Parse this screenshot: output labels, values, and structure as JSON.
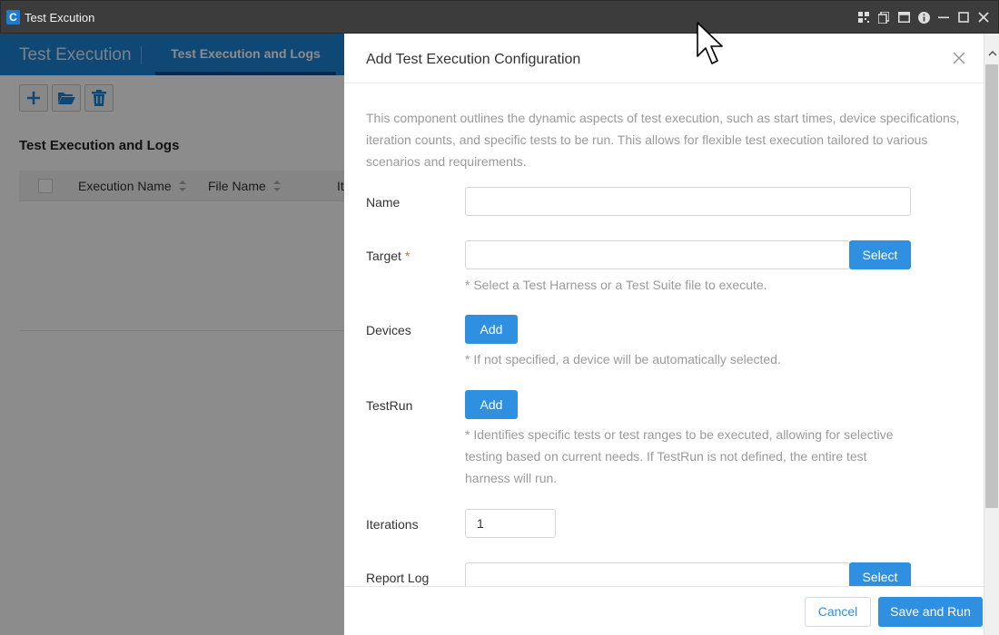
{
  "window": {
    "title": "Test Excution",
    "logo_letter": "C"
  },
  "app": {
    "name": "Test Execution",
    "active_tab": "Test Execution and Logs",
    "section_title": "Test Execution and Logs",
    "table": {
      "columns": [
        "Execution Name",
        "File Name",
        "It"
      ]
    }
  },
  "drawer": {
    "title": "Add Test Execution Configuration",
    "description": "This component outlines the dynamic aspects of test execution, such as start times, device specifications, iteration counts, and specific tests to be run. This allows for flexible test execution tailored to various scenarios and requirements.",
    "fields": {
      "name": {
        "label": "Name",
        "value": ""
      },
      "target": {
        "label": "Target",
        "required_mark": "*",
        "value": "",
        "button": "Select",
        "hint": "* Select a Test Harness or a Test Suite file to execute."
      },
      "devices": {
        "label": "Devices",
        "button": "Add",
        "hint": "* If not specified, a device will be automatically selected."
      },
      "testrun": {
        "label": "TestRun",
        "button": "Add",
        "hint_line1": "* Identifies specific tests or test ranges to be executed, allowing for selective",
        "hint_line2": "testing based on current needs. If TestRun is not defined, the entire test",
        "hint_line3": "harness will run."
      },
      "iterations": {
        "label": "Iterations",
        "value": "1"
      },
      "report_log": {
        "label": "Report Log",
        "value": "",
        "button": "Select"
      }
    },
    "footer": {
      "cancel": "Cancel",
      "save": "Save and Run"
    }
  },
  "colors": {
    "accent": "#2f8fe0",
    "header_blue": "#1e83d6",
    "required": "#e8612c",
    "titlebar": "#3c3c3c"
  }
}
